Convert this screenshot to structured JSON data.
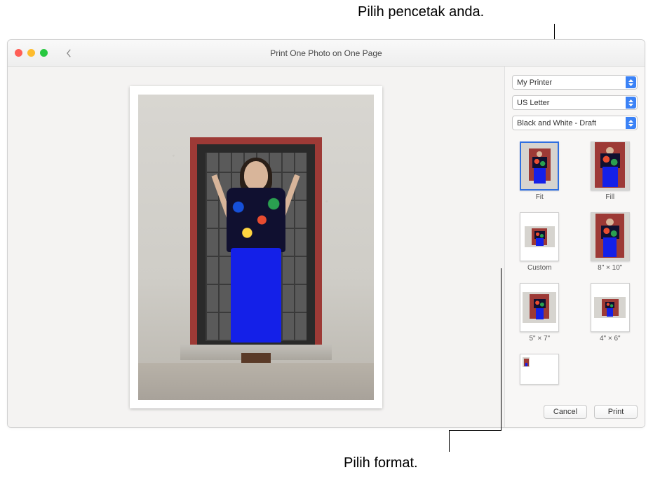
{
  "callouts": {
    "top": "Pilih pencetak anda.",
    "bottom": "Pilih format."
  },
  "window": {
    "title": "Print One Photo on One Page"
  },
  "selects": {
    "printer": "My Printer",
    "paper": "US Letter",
    "quality": "Black and White - Draft"
  },
  "layouts": [
    {
      "id": "fit",
      "label": "Fit",
      "selected": true,
      "orientation": "portrait",
      "style": "fit"
    },
    {
      "id": "fill",
      "label": "Fill",
      "selected": false,
      "orientation": "portrait",
      "style": "fill"
    },
    {
      "id": "custom",
      "label": "Custom",
      "selected": false,
      "orientation": "portrait",
      "style": "custom"
    },
    {
      "id": "8x10",
      "label": "8\" × 10\"",
      "selected": false,
      "orientation": "portrait",
      "style": "fill"
    },
    {
      "id": "5x7",
      "label": "5\" × 7\"",
      "selected": false,
      "orientation": "portrait",
      "style": "5x7"
    },
    {
      "id": "4x6",
      "label": "4\" × 6\"",
      "selected": false,
      "orientation": "portrait",
      "style": "4x6"
    },
    {
      "id": "contact",
      "label": "",
      "selected": false,
      "orientation": "landscape",
      "style": "contact"
    }
  ],
  "buttons": {
    "cancel": "Cancel",
    "print": "Print"
  }
}
